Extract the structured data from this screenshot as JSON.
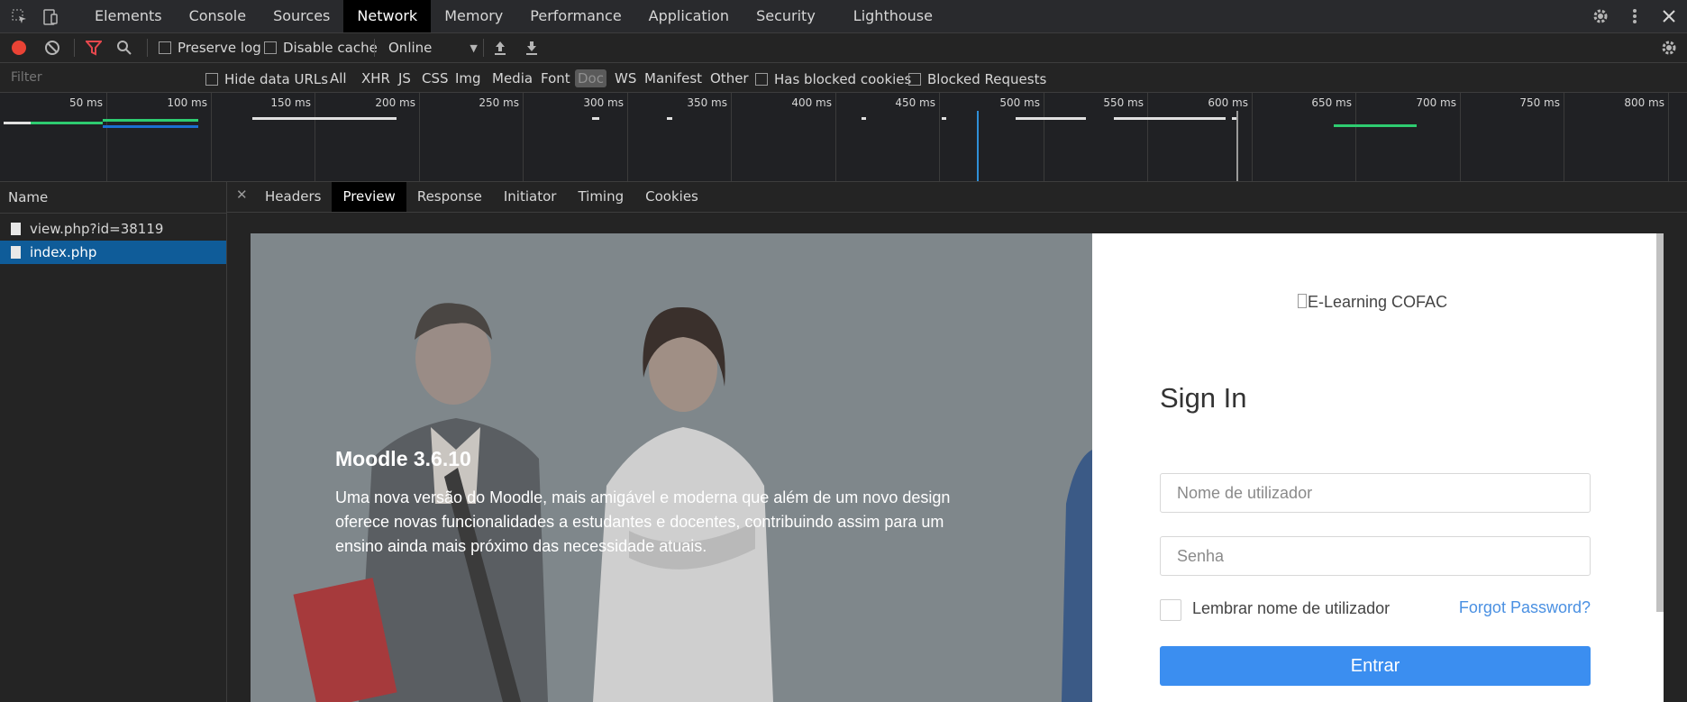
{
  "devtools": {
    "tabs": [
      "Elements",
      "Console",
      "Sources",
      "Network",
      "Memory",
      "Performance",
      "Application",
      "Security",
      "Lighthouse"
    ],
    "active_tab": "Network"
  },
  "toolbar": {
    "preserve_log": "Preserve log",
    "disable_cache": "Disable cache",
    "throttling": "Online"
  },
  "filterbar": {
    "filter_placeholder": "Filter",
    "hide_data_urls": "Hide data URLs",
    "types": [
      "All",
      "XHR",
      "JS",
      "CSS",
      "Img",
      "Media",
      "Font",
      "Doc",
      "WS",
      "Manifest",
      "Other"
    ],
    "active_type": "Doc",
    "has_blocked_cookies": "Has blocked cookies",
    "blocked_requests": "Blocked Requests"
  },
  "timeline": {
    "ticks": [
      "50 ms",
      "100 ms",
      "150 ms",
      "200 ms",
      "250 ms",
      "300 ms",
      "350 ms",
      "400 ms",
      "450 ms",
      "500 ms",
      "550 ms",
      "600 ms",
      "650 ms",
      "700 ms",
      "750 ms",
      "800 ms"
    ]
  },
  "requests": {
    "header": "Name",
    "items": [
      "view.php?id=38119",
      "index.php"
    ],
    "selected": "index.php"
  },
  "detail": {
    "tabs": [
      "Headers",
      "Preview",
      "Response",
      "Initiator",
      "Timing",
      "Cookies"
    ],
    "active_tab": "Preview"
  },
  "preview": {
    "hero_title": "Moodle 3.6.10",
    "hero_text": "Uma nova  versão do Moodle, mais amigável e moderna que além de um novo design oferece novas funcionalidades a estudantes e docentes, contribuindo assim para um ensino ainda mais próximo das necessidade atuais.",
    "logo_alt": "E-Learning COFAC",
    "signin": "Sign In",
    "username_placeholder": "Nome de utilizador",
    "password_placeholder": "Senha",
    "remember": "Lembrar nome de utilizador",
    "forgot": "Forgot Password?",
    "submit": "Entrar"
  },
  "colors": {
    "record": "#ea4335",
    "filter_active": "#e5484d",
    "selected_row": "#0f5c99",
    "button": "#3b8ef0",
    "link": "#4a90e2"
  }
}
